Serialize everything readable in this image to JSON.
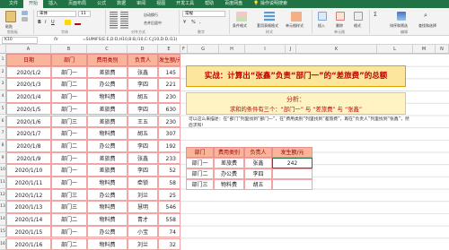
{
  "ribbon_tabs": [
    "文件",
    "开始",
    "插入",
    "页面布局",
    "公式",
    "数据",
    "审阅",
    "视图",
    "开发工具",
    "帮助",
    "百度网盘",
    "操作说明搜索"
  ],
  "ribbon_groups": [
    "剪贴板",
    "字体",
    "对齐方式",
    "数字",
    "样式",
    "单元格",
    "编辑"
  ],
  "ribbon_labels": {
    "paste": "粘贴",
    "font_name": "宋体",
    "font_size": "11",
    "wrap": "自动换行",
    "merge": "合并后居中",
    "number_format": "常规",
    "cond_format": "条件格式",
    "table_format": "套用表格格式",
    "cell_style": "单元格样式",
    "insert": "插入",
    "delete": "删除",
    "format": "格式",
    "sort": "排序和筛选",
    "find": "查找和选择"
  },
  "formula_bar": {
    "name_box": "K10",
    "fx": "fx",
    "formula": "=SUMIFS(E:E,D:D,H10,B:B,I10,C:C,J10,D:D,I11)"
  },
  "columns": [
    "A",
    "B",
    "C",
    "D",
    "E",
    "F",
    "G",
    "H",
    "I",
    "J",
    "K",
    "L",
    "M",
    "N"
  ],
  "rows": [
    "1",
    "2",
    "3",
    "4",
    "5",
    "6",
    "7",
    "8",
    "9",
    "10",
    "11",
    "12",
    "13",
    "14",
    "15",
    "16"
  ],
  "table": {
    "headers": [
      "日期",
      "部门",
      "费用类别",
      "负责人",
      "发生额/元"
    ],
    "rows": [
      [
        "2020/1/2",
        "部门一",
        "差旅费",
        "张鑫",
        "145"
      ],
      [
        "2020/1/3",
        "部门二",
        "办公费",
        "李四",
        "221"
      ],
      [
        "2020/1/4",
        "部门一",
        "物料费",
        "胡五",
        "230"
      ],
      [
        "2020/1/5",
        "部门一",
        "差旅费",
        "李四",
        "630"
      ],
      [
        "2020/1/6",
        "部门三",
        "差旅费",
        "王五",
        "230"
      ],
      [
        "2020/1/7",
        "部门一",
        "物料费",
        "胡五",
        "307"
      ],
      [
        "2020/1/8",
        "部门二",
        "办公费",
        "李四",
        "192"
      ],
      [
        "2020/1/9",
        "部门一",
        "差旅费",
        "张鑫",
        "233"
      ],
      [
        "2020/1/10",
        "部门一",
        "差旅费",
        "李四",
        "52"
      ],
      [
        "2020/1/11",
        "部门一",
        "物料费",
        "牵锁",
        "58"
      ],
      [
        "2020/1/12",
        "部门三",
        "办公费",
        "刘兰",
        "25"
      ],
      [
        "2020/1/13",
        "部门三",
        "物料费",
        "慧明",
        "546"
      ],
      [
        "2020/1/14",
        "部门二",
        "物料费",
        "青才",
        "558"
      ],
      [
        "2020/1/15",
        "部门一",
        "办公费",
        "小宝",
        "74"
      ],
      [
        "2020/1/16",
        "部门二",
        "物料费",
        "刘兰",
        "32"
      ]
    ]
  },
  "banner": "实战：计算出“张鑫”负责“部门一”的“差旅费”的总额",
  "analysis": {
    "title": "分析：",
    "text": "求和的条件有三个：“部门一”   与   “差旅费”   与   “张鑫”"
  },
  "note": "可以这么来描述：在“部门”列里找到“部门一”，在“费用类别”列里找到“差旅费”，再在“负责人”列里找到“张鑫”，然后求和！",
  "result_table": {
    "headers": [
      "部门",
      "费用类别",
      "负责人",
      "发生额/元"
    ],
    "rows": [
      [
        "部门一",
        "差旅费",
        "张鑫",
        "242"
      ],
      [
        "部门二",
        "办公费",
        "李四",
        ""
      ],
      [
        "部门三",
        "物料费",
        "胡五",
        ""
      ]
    ]
  }
}
